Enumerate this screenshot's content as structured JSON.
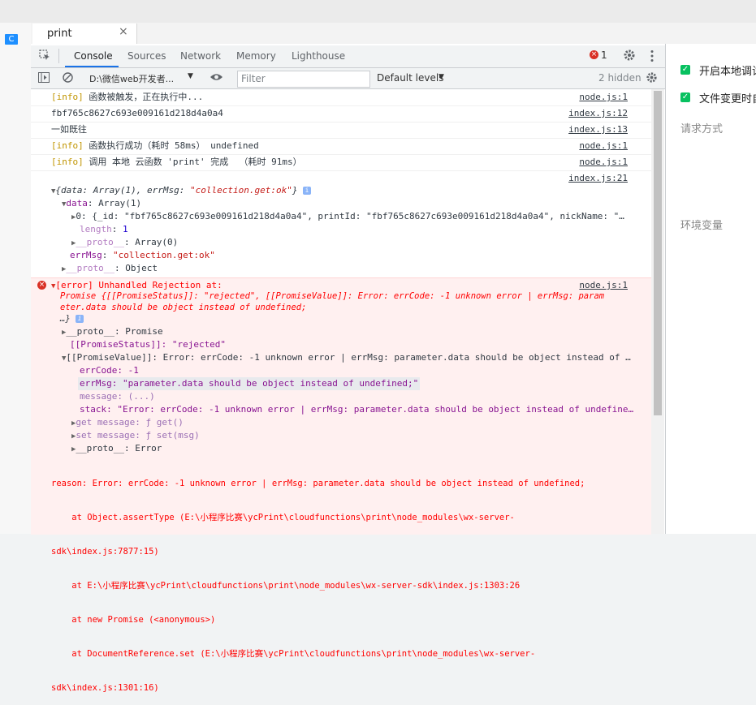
{
  "window": {
    "left_badge": "C",
    "file_tab": "print",
    "close_glyph": "×"
  },
  "toolbar": {
    "tabs": [
      "Console",
      "Sources",
      "Network",
      "Memory",
      "Lighthouse"
    ],
    "error_count": "1"
  },
  "filterbar": {
    "context": "D:\\微信web开发者...",
    "filter_placeholder": "Filter",
    "levels": "Default levels",
    "hidden": "2 hidden"
  },
  "logs": [
    {
      "prefix": "[info]",
      "text": " 函数被触发，正在执行中...",
      "source": "node.js:1"
    },
    {
      "prefix": "",
      "text": "fbf765c8627c693e009161d218d4a0a4",
      "source": "index.js:12"
    },
    {
      "prefix": "",
      "text": "一如既往",
      "source": "index.js:13"
    },
    {
      "prefix": "[info]",
      "text": " 函数执行成功（耗时 58ms） undefined",
      "source": "node.js:1"
    },
    {
      "prefix": "[info]",
      "text": " 调用 本地 云函数 'print' 完成  （耗时 91ms）",
      "source": "node.js:1"
    }
  ],
  "object_log": {
    "source": "index.js:21",
    "summary_open": "{data: Array(1), errMsg: ",
    "summary_str": "\"collection.get:ok\"",
    "summary_close": "}",
    "data_key": "data",
    "data_val": ": Array(1)",
    "item0": "0: {_id: \"fbf765c8627c693e009161d218d4a0a4\", printId: \"fbf765c8627c693e009161d218d4a0a4\", nickName: \"…",
    "length_key": "length",
    "length_val": "1",
    "proto_key": "__proto__",
    "proto_arr": ": Array(0)",
    "errmsg_key": "errMsg",
    "errmsg_val": "\"collection.get:ok\"",
    "proto_obj": ": Object"
  },
  "error_log": {
    "source": "node.js:1",
    "head": "[error] Unhandled Rejection at:",
    "promise_line1": "Promise {[[PromiseStatus]]: \"rejected\", [[PromiseValue]]: Error: errCode: -1 unknown error | errMsg: param",
    "promise_line2": "eter.data should be object instead of undefined;",
    "promise_line3": "…}",
    "proto_promise": "__proto__: Promise",
    "status": "[[PromiseStatus]]: \"rejected\"",
    "value": "[[PromiseValue]]: Error: errCode: -1 unknown error | errMsg: parameter.data should be object instead of …",
    "errcode": "errCode: -1",
    "errmsg": "errMsg: \"parameter.data should be object instead of undefined;\"",
    "message": "message: (...)",
    "stack": "stack: \"Error: errCode: -1 unknown error | errMsg: parameter.data should be object instead of undefine…",
    "get_message": "get message: ƒ get()",
    "set_message": "set message: ƒ set(msg)",
    "proto_error": "__proto__: Error",
    "reason": "reason: Error: errCode: -1 unknown error | errMsg: parameter.data should be object instead of undefined;",
    "at1a": "    at Object.assertType (E:\\小程序比赛\\ycPrint\\cloudfunctions\\print\\node_modules\\wx-server-",
    "at1b": "sdk\\index.js:7877:15)",
    "at2": "    at E:\\小程序比赛\\ycPrint\\cloudfunctions\\print\\node_modules\\wx-server-sdk\\index.js:1303:26",
    "at3": "    at new Promise (<anonymous>)",
    "at4a": "    at DocumentReference.set (E:\\小程序比赛\\ycPrint\\cloudfunctions\\print\\node_modules\\wx-server-",
    "at4b": "sdk\\index.js:1301:16)"
  },
  "right_panel": {
    "opt1": "开启本地调试",
    "opt2": "文件变更时自动",
    "section1": "请求方式",
    "section2": "环境变量"
  },
  "colors": {
    "accent": "#1a73e8",
    "error": "#ff0000",
    "info": "#c19500",
    "check": "#07c160"
  }
}
